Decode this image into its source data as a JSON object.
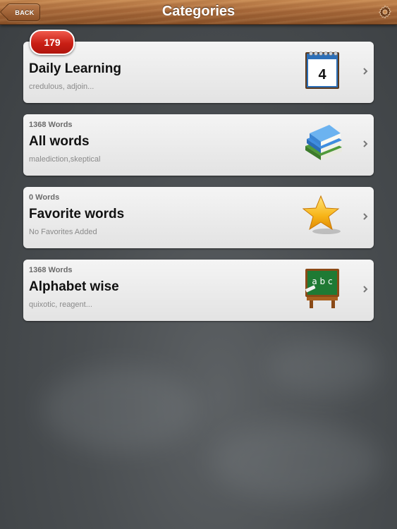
{
  "navbar": {
    "title": "Categories",
    "back_label": "BACK",
    "settings_icon": "gear-icon"
  },
  "badge": {
    "count": "179"
  },
  "categories": [
    {
      "count": "",
      "title": "Daily Learning",
      "subtitle": "credulous, adjoin...",
      "icon": "calendar-icon",
      "calendar_day": "4"
    },
    {
      "count": "1368 Words",
      "title": "All words",
      "subtitle": "malediction,skeptical",
      "icon": "books-icon"
    },
    {
      "count": "0 Words",
      "title": "Favorite words",
      "subtitle": "No Favorites Added",
      "icon": "star-icon"
    },
    {
      "count": "1368 Words",
      "title": "Alphabet wise",
      "subtitle": "quixotic, reagent...",
      "icon": "chalkboard-icon",
      "board_text": "a b c"
    }
  ],
  "colors": {
    "navbar_wood": "#a8693a",
    "background_chalkboard": "#4a4e51",
    "badge_red": "#c91f15",
    "card": "#ececec"
  }
}
